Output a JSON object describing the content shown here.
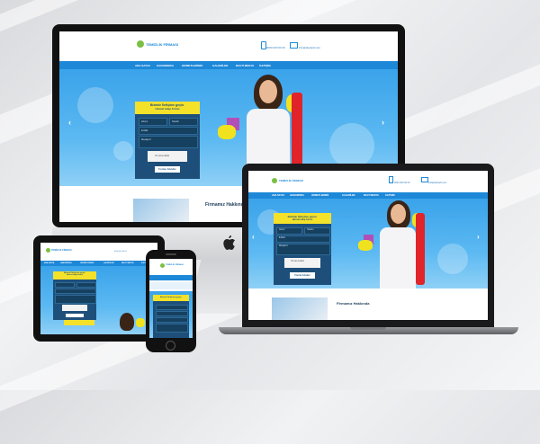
{
  "site": {
    "logo": "TEMİZLİK FİRMASI",
    "nav": [
      "ANA SAYFA",
      "HAKKIMIZDA",
      "HİZMETLERİMİZ",
      "GALERİLER",
      "MULTİ MEDYA",
      "İLETİŞİM"
    ],
    "phone_label": "0000 000 00 00",
    "email_label": "info@alanadi.com",
    "form_title_line1": "Bizimle İletişime geçin.",
    "form_title_line2": "Hizmet talep formu",
    "fields": [
      "Adınız",
      "Telefon",
      "E-Mail",
      "Mesajınız"
    ],
    "captcha_text": "I'm not a robot",
    "submit_label": "Formu Gönder",
    "about_title": "Firmamız Hakkında",
    "mobile_form_title": "Bizimle İletişime geçin."
  },
  "colors": {
    "primary_blue": "#1e88d8",
    "form_navy": "#1e4f7a",
    "accent_yellow": "#f4e12a",
    "bottle_red": "#e0242a"
  },
  "icons": {
    "apple_logo": "apple-icon",
    "phone": "phone-icon",
    "envelope": "envelope-icon"
  }
}
